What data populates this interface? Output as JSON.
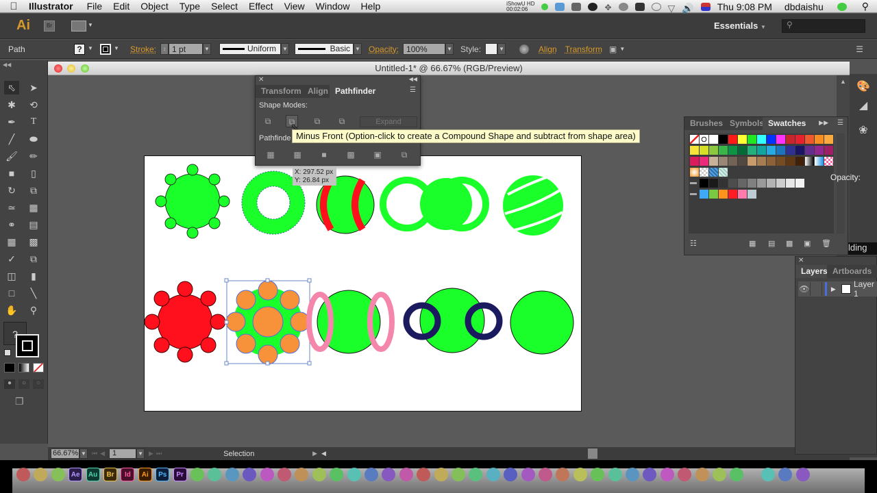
{
  "menubar": {
    "app_name": "Illustrator",
    "items": [
      "File",
      "Edit",
      "Object",
      "Type",
      "Select",
      "Effect",
      "View",
      "Window",
      "Help"
    ],
    "recorder_label": "iShowU HD",
    "recorder_time": "00:02:06",
    "clock": "Thu 9:08 PM",
    "user": "dbdaishu"
  },
  "appbar": {
    "logo": "Ai",
    "bridge_label": "Br",
    "workspace": "Essentials",
    "search_placeholder": ""
  },
  "control_bar": {
    "selection_type": "Path",
    "fill_value": "?",
    "stroke_label": "Stroke:",
    "stroke_weight": "1 pt",
    "profile": "Uniform",
    "brush": "Basic",
    "opacity_label": "Opacity:",
    "opacity_value": "100%",
    "style_label": "Style:",
    "align_link": "Align",
    "transform_link": "Transform"
  },
  "document": {
    "title": "Untitled-1* @ 66.67% (RGB/Preview)",
    "zoom": "66.67%",
    "artboard_number": "1",
    "status_tool": "Selection"
  },
  "pathfinder_panel": {
    "tabs": [
      "Transform",
      "Align",
      "Pathfinder"
    ],
    "active_tab": "Pathfinder",
    "shape_modes_label": "Shape Modes:",
    "pathfinders_label": "Pathfinde",
    "expand_label": "Expand",
    "shape_mode_buttons": [
      "Unite",
      "Minus Front",
      "Intersect",
      "Exclude"
    ],
    "pathfinder_buttons": [
      "Divide",
      "Trim",
      "Merge",
      "Crop",
      "Outline",
      "Minus Back"
    ],
    "tooltip": "Minus Front (Option-click to create a Compound Shape and subtract from shape area)"
  },
  "smart_guide": {
    "x": "X: 297.52 px",
    "y": "Y: 26.84 px"
  },
  "swatches_panel": {
    "tabs": [
      "Brushes",
      "Symbols",
      "Swatches"
    ],
    "active_tab": "Swatches",
    "rows": [
      [
        "none",
        "registration",
        "#ffffff",
        "#000000",
        "#ff1a1a",
        "#ffff33",
        "#22e622",
        "#33ffff",
        "#0033ff",
        "#ff33ff",
        "#c9252c",
        "#e8222d",
        "#f0582d",
        "#f68e22",
        "#fbaa3d"
      ],
      [
        "#f7e43a",
        "#d6df25",
        "#8dc63f",
        "#39b54a",
        "#0b9444",
        "#046a38",
        "#22b07b",
        "#12a59e",
        "#27aae1",
        "#1c75bc",
        "#2e3192",
        "#1b1464",
        "#662d91",
        "#92278f",
        "#9e1f63"
      ],
      [
        "#da1c5c",
        "#ec2a7b",
        "#c7b299",
        "#998675",
        "#736357",
        "#534741",
        "#c69c6d",
        "#a67c52",
        "#8c6239",
        "#754c24",
        "#603813",
        "#42210b",
        "grad-bw",
        "grad-blue",
        "grad-pink"
      ],
      [
        "grad-orange",
        "pattern-1",
        "pattern-2",
        "pattern-3"
      ],
      [
        "folder",
        "#000000",
        "#1a1a1a",
        "#333333",
        "#4d4d4d",
        "#666666",
        "#808080",
        "#999999",
        "#b3b3b3",
        "#cccccc",
        "#e6e6e6",
        "#f2f2f2"
      ],
      [
        "folder",
        "#3fa9f5",
        "#7ac943",
        "#ff931e",
        "#ff1d25",
        "#ff7bac",
        "#bdccd4"
      ]
    ]
  },
  "right_dock": {
    "opacity_label": "Opacity:",
    "partial_text": "lding"
  },
  "layers_panel": {
    "tabs": [
      "Layers",
      "Artboards"
    ],
    "active_tab": "Layers",
    "layers": [
      {
        "name": "Layer 1"
      }
    ]
  },
  "artwork": {
    "colors": {
      "green": "#1aff2a",
      "red": "#ff101c",
      "orange": "#f7923a",
      "pink": "#f586ab",
      "navy": "#1b1a5e"
    }
  },
  "dock": {
    "apps": [
      "Finder",
      "Launchpad",
      "Transmit",
      "Ae",
      "Au",
      "Br",
      "Id",
      "Ai",
      "Ps",
      "Pr",
      "Clapper",
      "Compressor",
      "Mail",
      "Steam",
      "Safari",
      "HD",
      "Pages",
      "Dictionary",
      "Preview",
      "Script",
      "Widget",
      "App Store",
      "iTunes",
      "Dashboard",
      "Safari",
      "Firefox",
      "FaceTime",
      "Contacts",
      "Preview",
      "Photo Booth",
      "Growl",
      "Toolbox",
      "Time Machine",
      "System Preferences",
      "EN",
      "Google Drive",
      "QQ",
      "Camera",
      "Folder",
      "Instruments",
      "Adium",
      "Skype",
      "Apps",
      "Downloads",
      "Trash"
    ]
  }
}
